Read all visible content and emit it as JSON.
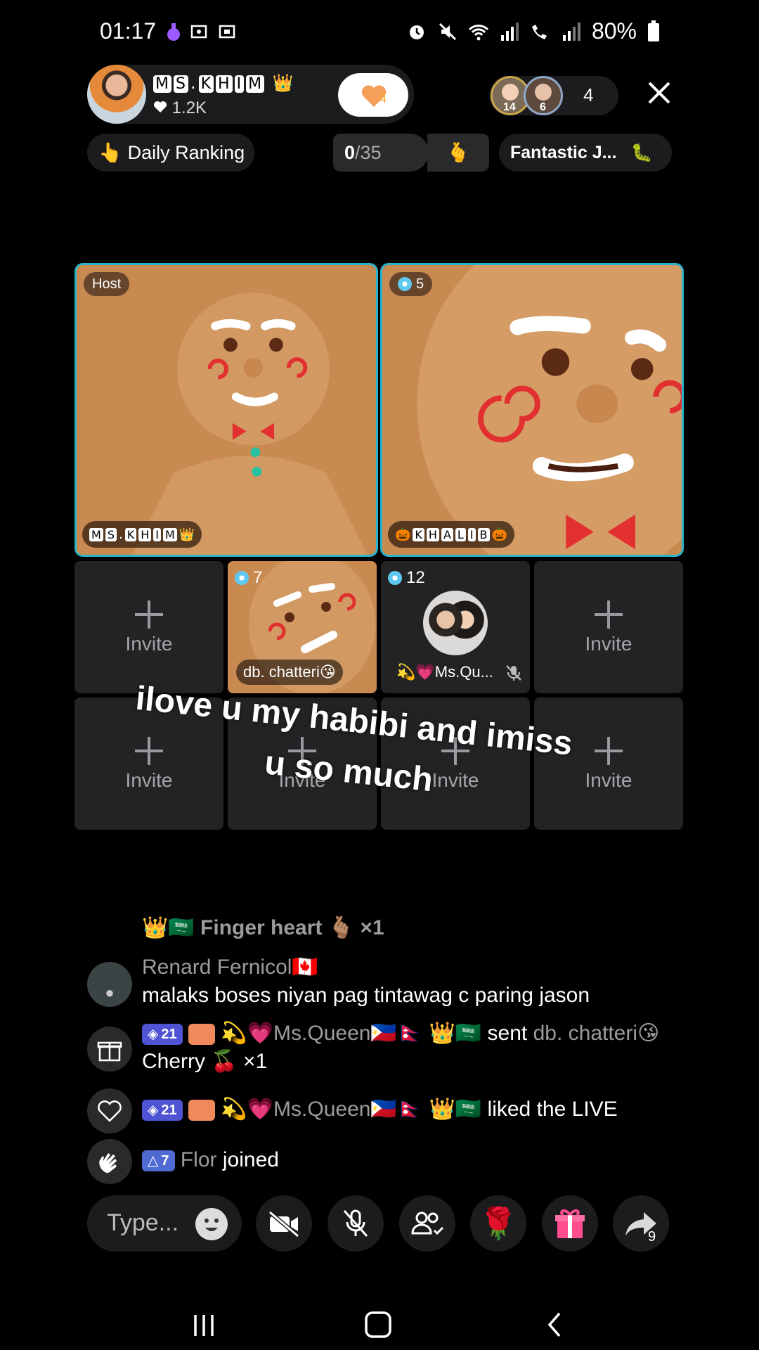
{
  "status": {
    "time": "01:17",
    "battery": "80%"
  },
  "host": {
    "name_letters": [
      "M",
      "S",
      ".",
      "K",
      "H",
      "I",
      "M"
    ],
    "crown": "👑",
    "likes": "1.2K",
    "heart_count": "4"
  },
  "viewers": {
    "avatar1_badge": "14",
    "avatar2_badge": "6",
    "count": "4"
  },
  "top_row": {
    "ranking_emoji": "👆",
    "ranking_label": "Daily Ranking",
    "progress_current": "0",
    "progress_total": "/35",
    "progress_emoji": "🫰",
    "fantastic_label": "Fantastic J...",
    "fantastic_emoji": "🐛"
  },
  "seats": {
    "host_tag": "Host",
    "host_nameplate_letters": [
      "M",
      "S",
      ".",
      "K",
      "H",
      "I",
      "M"
    ],
    "host_nameplate_crown": "👑",
    "guest_level": "5",
    "guest_nameplate_pre": "🎃",
    "guest_nameplate_letters": [
      "K",
      "H",
      "A",
      "L",
      "I",
      "B"
    ],
    "guest_nameplate_post": "🎃",
    "seat3_level": "7",
    "seat3_name": "db. chatteri😘",
    "seat4_level": "12",
    "seat4_name": "💫💗Ms.Qu...",
    "invite_label": "Invite"
  },
  "overlay": {
    "line1": "ilove u my habibi and imiss",
    "line2": "u so much"
  },
  "chat": [
    {
      "text": "👑🇸🇦 Finger heart 🫰🏽 ×1"
    },
    {
      "user": "Renard Fernicol🇨🇦",
      "text": "malaks boses niyan pag tintawag c paring jason"
    },
    {
      "level": "21",
      "user": "💫💗Ms.Queen🇵🇭🇳🇵 👑🇸🇦",
      "action": "sent",
      "target": "db. chatteri😘",
      "gift": "Cherry 🍒 ×1"
    },
    {
      "level": "21",
      "user": "💫💗Ms.Queen🇵🇭🇳🇵 👑🇸🇦",
      "action": "liked the LIVE"
    },
    {
      "level": "7",
      "user": "Flor",
      "action": "joined"
    }
  ],
  "bottom": {
    "type_placeholder": "Type...",
    "share_count": "9",
    "rose_emoji": "🌹"
  },
  "colors": {
    "seat_border": "#27b4c9",
    "level_badge": "#4e54d4",
    "gift_pink": "#ff4d8d"
  }
}
